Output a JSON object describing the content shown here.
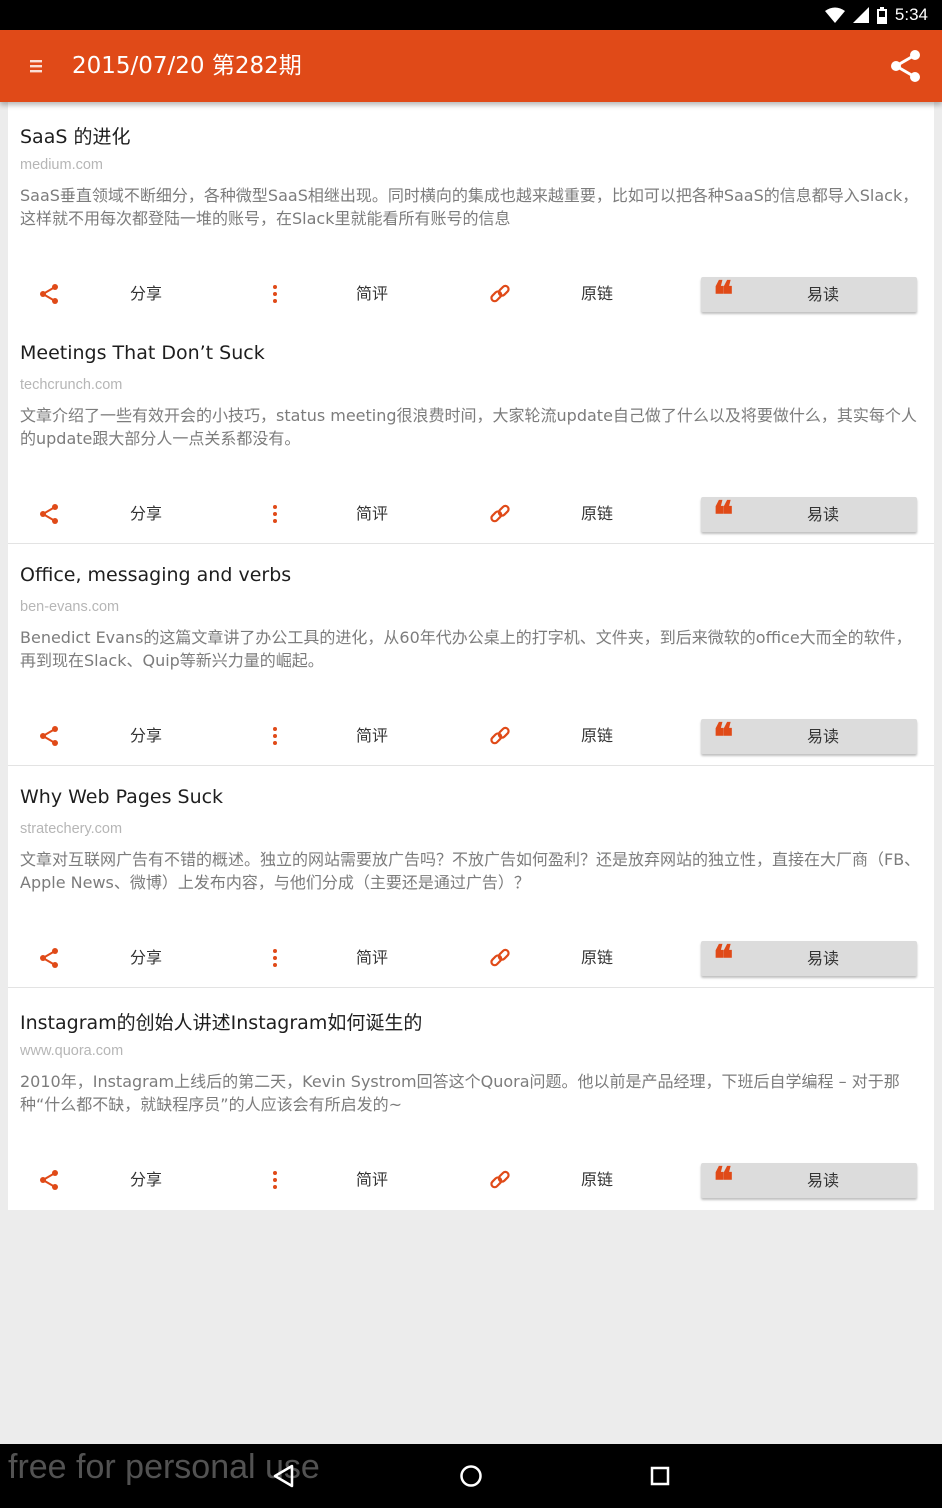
{
  "status_bar": {
    "time": "5:34"
  },
  "app_bar": {
    "title": "2015/07/20 第282期"
  },
  "colors": {
    "accent": "#e04a18",
    "read_button_bg": "#dcdcdc"
  },
  "actions": {
    "share_label": "分享",
    "comment_label": "简评",
    "link_label": "原链",
    "read_label": "易读",
    "share_icon": "share-icon",
    "comment_icon": "more-vertical-icon",
    "link_icon": "link-icon",
    "read_icon": "quote-icon"
  },
  "articles": [
    {
      "title": "SaaS 的进化",
      "source": "medium.com",
      "summary": "SaaS垂直领域不断细分，各种微型SaaS相继出现。同时横向的集成也越来越重要，比如可以把各种SaaS的信息都导入Slack，这样就不用每次都登陆一堆的账号，在Slack里就能看所有账号的信息"
    },
    {
      "title": "Meetings That Don’t Suck",
      "source": "techcrunch.com",
      "summary": "文章介绍了一些有效开会的小技巧，status meeting很浪费时间，大家轮流update自己做了什么以及将要做什么，其实每个人的update跟大部分人一点关系都没有。"
    },
    {
      "title": "Office, messaging and verbs",
      "source": "ben-evans.com",
      "summary": "Benedict Evans的这篇文章讲了办公工具的进化，从60年代办公桌上的打字机、文件夹，到后来微软的office大而全的软件，再到现在Slack、Quip等新兴力量的崛起。"
    },
    {
      "title": "Why Web Pages Suck",
      "source": "stratechery.com",
      "summary": "文章对互联网广告有不错的概述。独立的网站需要放广告吗？不放广告如何盈利？还是放弃网站的独立性，直接在大厂商（FB、Apple News、微博）上发布内容，与他们分成（主要还是通过广告）？"
    },
    {
      "title": "Instagram的创始人讲述Instagram如何诞生的",
      "source": "www.quora.com",
      "summary": "2010年，Instagram上线后的第二天，Kevin Systrom回答这个Quora问题。他以前是产品经理，下班后自学编程 – 对于那种“什么都不缺，就缺程序员”的人应该会有所启发的~"
    }
  ],
  "watermark": "free for personal use",
  "nav": {
    "back_icon": "back-triangle-icon",
    "home_icon": "home-circle-icon",
    "recents_icon": "recents-square-icon"
  }
}
